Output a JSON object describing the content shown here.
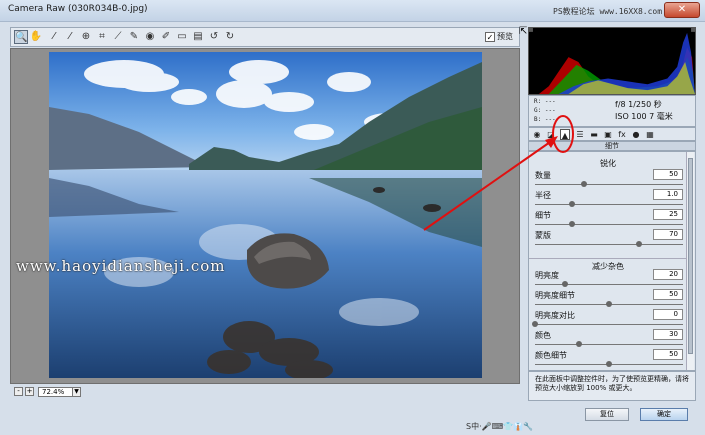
{
  "window": {
    "title": "Camera Raw (030R034B-0.jpg)",
    "site_tag": "PS教程论坛 www.16XX8.com",
    "close_glyph": "✕"
  },
  "toolbar": {
    "tools": [
      "zoom-icon",
      "hand-icon",
      "white-balance-icon",
      "color-sampler-icon",
      "target-adjust-icon",
      "crop-icon",
      "straighten-icon",
      "spot-removal-icon",
      "red-eye-icon",
      "adjustment-brush-icon",
      "graduated-filter-icon",
      "preferences-icon",
      "rotate-ccw-icon",
      "rotate-cw-icon"
    ],
    "preview_label": "预览",
    "preview_checked": true
  },
  "preview": {
    "watermark": "www.haoyidiansheji.com"
  },
  "zoom": {
    "minus": "-",
    "plus": "+",
    "value": "72.4%"
  },
  "info": {
    "r": "R:  ---",
    "g": "G:  ---",
    "b": "B:  ---",
    "line1": "f/8   1/250 秒",
    "line2": "ISO 100   7 毫米"
  },
  "tabs": [
    "basic-icon",
    "tone-curve-icon",
    "detail-icon",
    "hsl-icon",
    "split-toning-icon",
    "lens-corrections-icon",
    "fx-icon",
    "camera-calibration-icon",
    "presets-icon",
    "snapshots-icon"
  ],
  "panel": {
    "title": "细节",
    "sharpen_title": "锐化",
    "sharpen": [
      {
        "label": "数量",
        "value": "50",
        "pos": 0.33
      },
      {
        "label": "半径",
        "value": "1.0",
        "pos": 0.25
      },
      {
        "label": "细节",
        "value": "25",
        "pos": 0.25
      },
      {
        "label": "蒙版",
        "value": "70",
        "pos": 0.7
      }
    ],
    "noise_title": "减少杂色",
    "noise": [
      {
        "label": "明亮度",
        "value": "20",
        "pos": 0.2
      },
      {
        "label": "明亮度细节",
        "value": "50",
        "pos": 0.5
      },
      {
        "label": "明亮度对比",
        "value": "0",
        "pos": 0.0
      },
      {
        "label": "颜色",
        "value": "30",
        "pos": 0.3
      },
      {
        "label": "颜色细节",
        "value": "50",
        "pos": 0.5
      }
    ]
  },
  "note": "在此面板中调整控件时，为了使预览更精确，请将预览大小缩放到 100% 或更大。",
  "ime": "S中·🎤⌨👕👔🔧",
  "buttons": {
    "reset": "复位",
    "ok": "确定"
  }
}
